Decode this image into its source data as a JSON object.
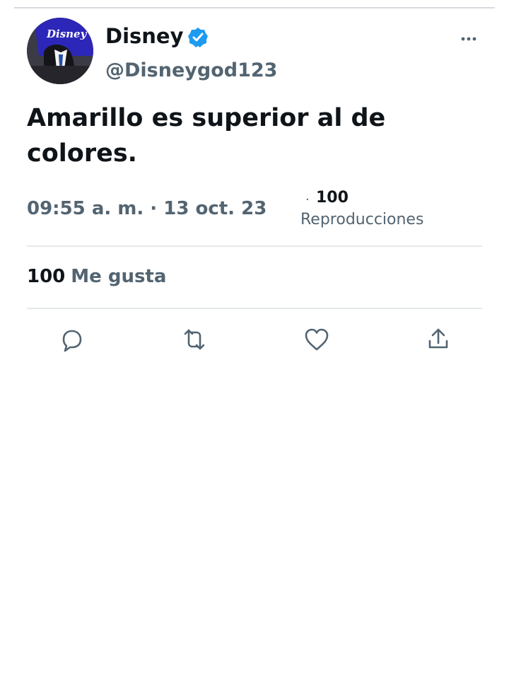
{
  "account": {
    "display_name": "Disney",
    "handle": "@Disneygod123",
    "verified_icon": "verified-badge-icon",
    "avatar_logo": "Disney"
  },
  "tweet": {
    "text": "Amarillo es superior al de colores.",
    "timestamp": "09:55 a. m. · 13 oct. 23",
    "views_separator": "·",
    "views_count": "100",
    "views_label": "Reproducciones",
    "likes_count": "100",
    "likes_label": "Me gusta"
  },
  "actions": [
    {
      "icon": "reply-icon"
    },
    {
      "icon": "retweet-icon"
    },
    {
      "icon": "like-icon"
    },
    {
      "icon": "share-icon"
    }
  ],
  "colors": {
    "accent": "#1d9bf0",
    "text": "#0f1419",
    "muted": "#536471",
    "divider": "#e5e8eb"
  }
}
